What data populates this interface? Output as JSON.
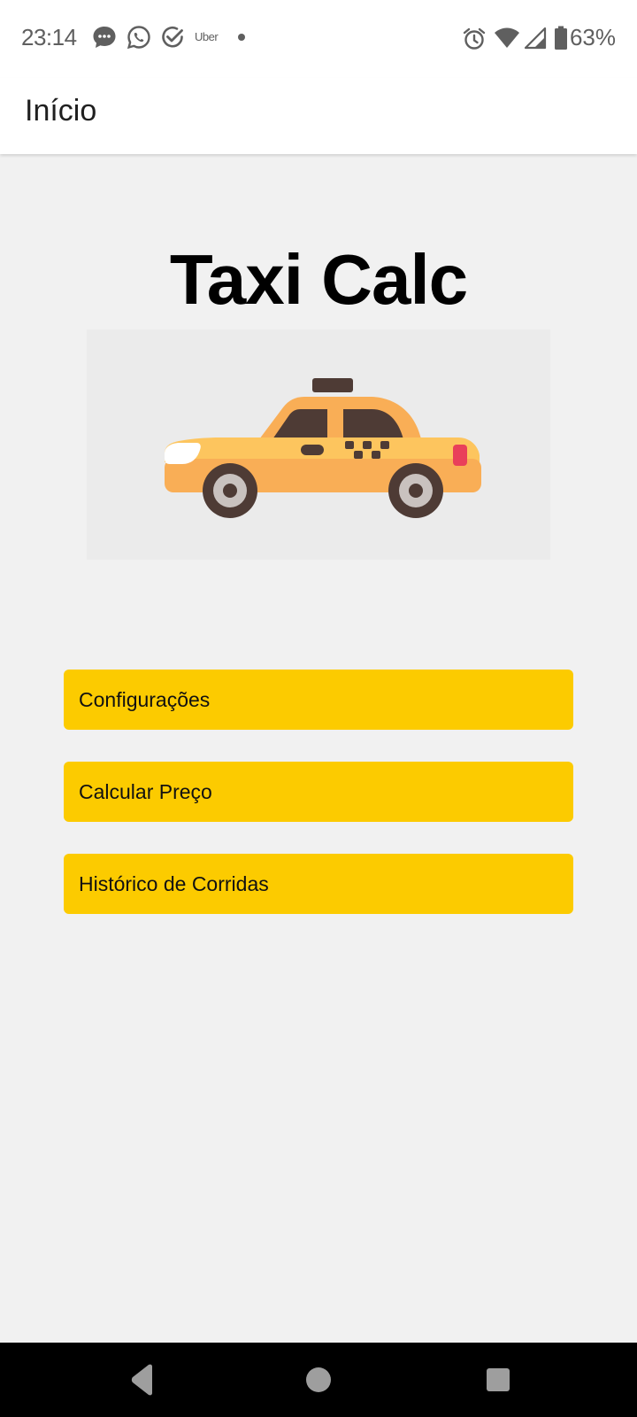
{
  "status_bar": {
    "time": "23:14",
    "notification_icons": [
      "messages-icon",
      "whatsapp-icon",
      "check-circle-icon",
      "uber-icon",
      "dot-icon"
    ],
    "uber_label": "Uber",
    "system_icons": [
      "alarm-icon",
      "wifi-icon",
      "signal-icon",
      "battery-icon"
    ],
    "battery": "63%"
  },
  "app_bar": {
    "title": "Início"
  },
  "main": {
    "heading": "Taxi Calc",
    "image": "taxi-car-illustration",
    "buttons": [
      {
        "label": "Configurações"
      },
      {
        "label": "Calcular Preço"
      },
      {
        "label": "Histórico de Corridas"
      }
    ]
  },
  "colors": {
    "button_bg": "#fccb00",
    "page_bg": "#f1f1f1",
    "taxi_body": "#fdc55e",
    "taxi_lower": "#f9ae56",
    "nav_bar": "#000000"
  },
  "nav_bar": {
    "buttons": [
      "back-icon",
      "home-icon",
      "recents-icon"
    ]
  }
}
